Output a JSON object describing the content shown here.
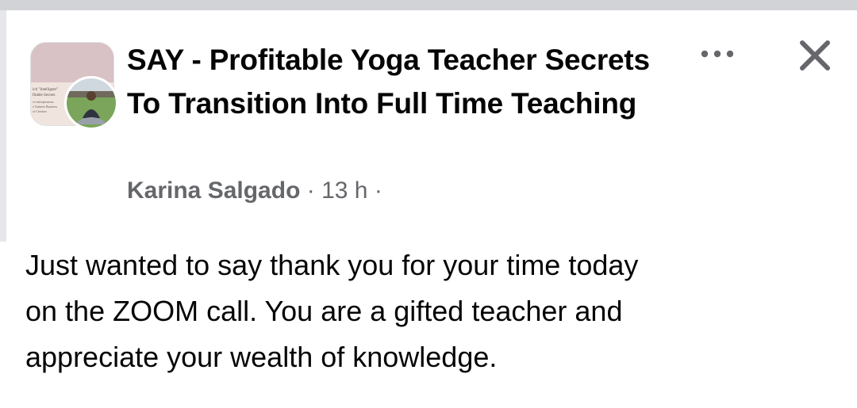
{
  "post": {
    "group_name": "SAY - Profitable Yoga Teacher Secrets To Transition Into Full Time Teaching",
    "author": "Karina Salgado",
    "separator": "·",
    "timestamp": "13 h",
    "trailing_separator": "·",
    "body": "Just wanted to say thank you for your time today\non the ZOOM call.  You are a gifted teacher and\nappreciate your wealth of knowledge."
  },
  "group_avatar": {
    "lines": [
      "ich \"Intelligent\"",
      "fitable Secrets",
      "ve entrepreneurs",
      "e Trainers Business",
      "or Creators"
    ]
  },
  "icons": {
    "more": "more-horizontal-icon",
    "close": "close-icon"
  },
  "colors": {
    "text_primary": "#050505",
    "text_secondary": "#65676b",
    "icon": "#65676b",
    "top_strip": "#d2d3d7"
  }
}
